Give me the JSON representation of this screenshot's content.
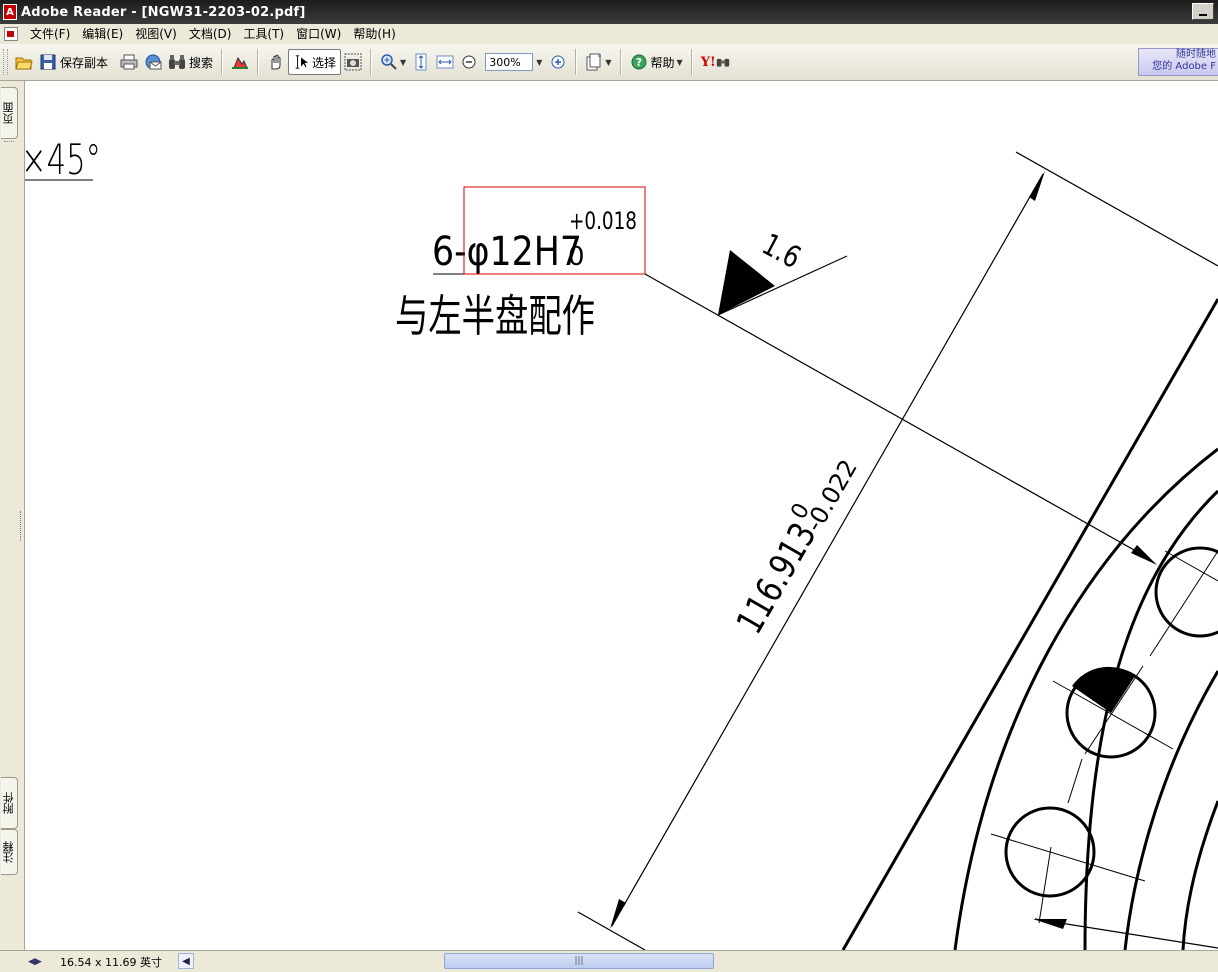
{
  "window": {
    "title": "Adobe Reader - [NGW31-2203-02.pdf]"
  },
  "menu": {
    "items": [
      "文件(F)",
      "编辑(E)",
      "视图(V)",
      "文档(D)",
      "工具(T)",
      "窗口(W)",
      "帮助(H)"
    ]
  },
  "toolbar": {
    "save_copy_label": "保存副本",
    "search_label": "搜索",
    "select_label": "选择",
    "zoom_value": "300%",
    "help_label": "帮助",
    "yahoo_label": "Y!",
    "ad_line1": "随时随地",
    "ad_line2": "您的 Adobe F"
  },
  "side_tabs": {
    "pages": "页面",
    "attachments": "附件",
    "comments": "注释"
  },
  "drawing": {
    "chamfer_label": "×45°",
    "hole_spec": "6-φ12H7",
    "tol_upper": "+0.018",
    "tol_lower": "0",
    "note": "与左半盘配作",
    "roughness": "1.6",
    "dimension_main": "116.913",
    "dim_tol_upper": "0",
    "dim_tol_lower": "-0.022"
  },
  "status": {
    "page_size": "16.54 x 11.69 英寸"
  }
}
